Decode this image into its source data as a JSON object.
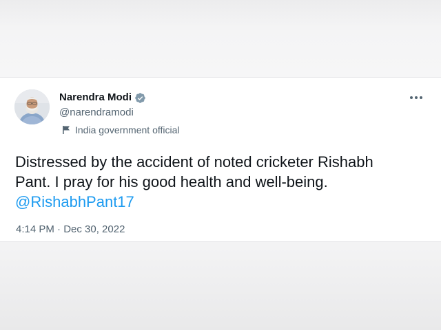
{
  "tweet": {
    "author": {
      "display_name": "Narendra Modi",
      "handle": "@narendramodi",
      "verified_icon": "verified-badge-icon",
      "affiliation": "India government official",
      "affiliation_icon": "flag-icon",
      "avatar": "profile-photo"
    },
    "text_line1": "Distressed by the accident of noted cricketer Rishabh",
    "text_line2": "Pant. I pray for his good health and well-being.",
    "mention": "@RishabhPant17",
    "timestamp": "4:14 PM · Dec 30, 2022",
    "more_icon": "more-options-icon"
  },
  "colors": {
    "text": "#0f1419",
    "secondary_text": "#536471",
    "link": "#1d9bf0",
    "verified": "#829aab"
  }
}
